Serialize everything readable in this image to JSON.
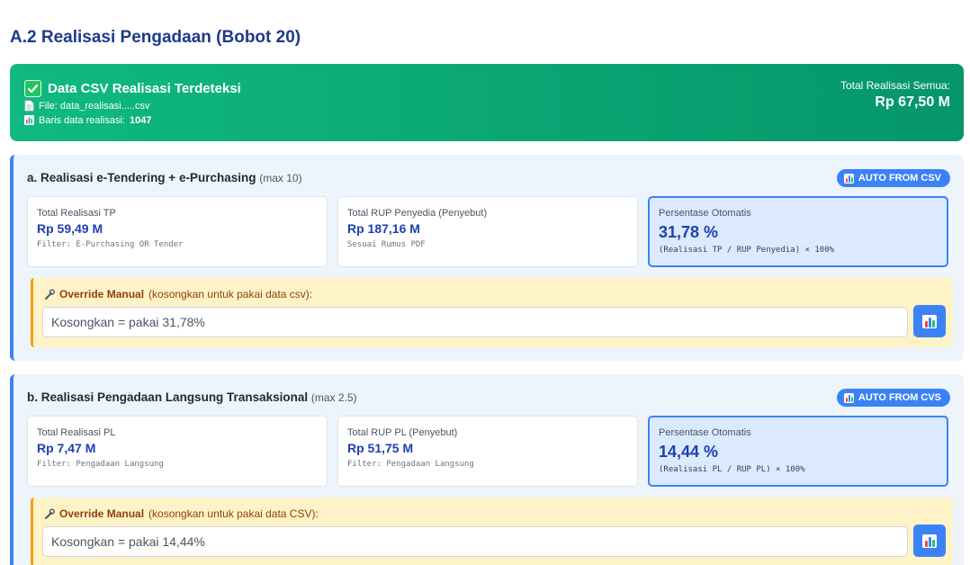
{
  "page": {
    "title": "A.2 Realisasi Pengadaan (Bobot 20)"
  },
  "banner": {
    "title": "Data CSV Realisasi Terdeteksi",
    "file_label": "File: data_realisasi.....csv",
    "rows_label": "Baris data realisasi:",
    "rows_value": "1047",
    "total_label": "Total Realisasi Semua:",
    "total_value": "Rp 67,50 M"
  },
  "sections": [
    {
      "title": "a. Realisasi e-Tendering + e-Purchasing",
      "max": "(max 10)",
      "badge": "AUTO FROM CSV",
      "cards": [
        {
          "label": "Total Realisasi TP",
          "value": "Rp 59,49 M",
          "note": "Filter: E-Purchasing OR Tender"
        },
        {
          "label": "Total RUP Penyedia (Penyebut)",
          "value": "Rp 187,16 M",
          "note": "Sesuai Rumus PDF"
        },
        {
          "label": "Persentase Otomatis",
          "value": "31,78 %",
          "note": "(Realisasi TP / RUP Penyedia) × 100%"
        }
      ],
      "override": {
        "label_bold": "Override Manual",
        "label_rest": "(kosongkan untuk pakai data csv):",
        "placeholder": "Kosongkan = pakai 31,78%"
      }
    },
    {
      "title": "b. Realisasi Pengadaan Langsung Transaksional",
      "max": "(max 2.5)",
      "badge": "AUTO FROM CVS",
      "cards": [
        {
          "label": "Total Realisasi PL",
          "value": "Rp 7,47 M",
          "note": "Filter: Pengadaan Langsung"
        },
        {
          "label": "Total RUP PL (Penyebut)",
          "value": "Rp 51,75 M",
          "note": "Filter: Pengadaan Langsung"
        },
        {
          "label": "Persentase Otomatis",
          "value": "14,44 %",
          "note": "(Realisasi PL / RUP PL) × 100%"
        }
      ],
      "override": {
        "label_bold": "Override Manual",
        "label_rest": "(kosongkan untuk pakai data CSV):",
        "placeholder": "Kosongkan = pakai 14,44%"
      }
    }
  ],
  "colors": {
    "accent": "#3b82f6",
    "success": "#10b981",
    "warning_bg": "#fef3c7"
  },
  "icons": [
    "check-icon",
    "file-icon",
    "bar-chart-icon",
    "wrench-icon"
  ]
}
